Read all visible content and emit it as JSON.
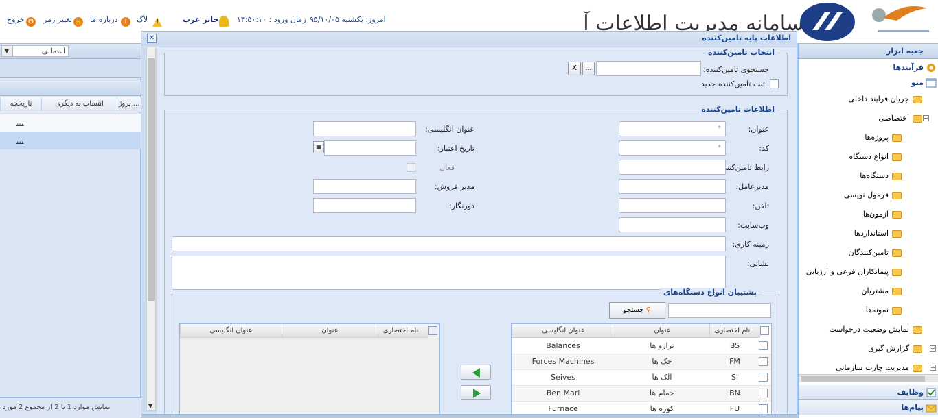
{
  "header": {
    "exit": "خروج",
    "change_password": "تغییر رمز",
    "about": "درباره ما",
    "log": "لاگ",
    "user": "جابر عرب",
    "login_time": "زمان ورود : ۱۳:۵۰:۱۰",
    "today": "امروز: یکشنبه ۹۵/۱۰/۰۵",
    "banner": "سامانه مدیریت اطلاعات آزمایشگاه"
  },
  "left_panel": {
    "theme_value": "آسمانی",
    "columns": [
      "تاریخچه",
      "انتساب به دیگری",
      "پروژ ..."
    ],
    "rows": [
      "...",
      "..."
    ],
    "status": "نمایش موارد 1 تا 2 از مجموع 2 مورد"
  },
  "right_panel": {
    "toolbox": "جعبه ابزار",
    "processes": "فرآیندها",
    "menu": "منو",
    "tree": [
      {
        "label": "جریان فرایند داخلی",
        "level": 1
      },
      {
        "label": "اختصاصی",
        "level": 1,
        "toggle": "−"
      },
      {
        "label": "پروژه‌ها",
        "level": 2
      },
      {
        "label": "انواع دستگاه",
        "level": 2
      },
      {
        "label": "دستگاه‌ها",
        "level": 2
      },
      {
        "label": "فرمول نویسی",
        "level": 2
      },
      {
        "label": "آزمون‌ها",
        "level": 2
      },
      {
        "label": "استانداردها",
        "level": 2
      },
      {
        "label": "تامین‌کنندگان",
        "level": 2
      },
      {
        "label": "پیمانکاران فرعی و ارزیابی",
        "level": 2
      },
      {
        "label": "مشتریان",
        "level": 2
      },
      {
        "label": "نمونه‌ها",
        "level": 2
      },
      {
        "label": "نمایش وضعیت درخواست",
        "level": 1
      },
      {
        "label": "گزارش گیری",
        "level": 1,
        "toggle": "+"
      },
      {
        "label": "مدیریت چارت سازمانی",
        "level": 1,
        "toggle": "+"
      }
    ],
    "tasks": "وظایف",
    "messages": "پیام‌ها"
  },
  "dialog": {
    "title": "اطلاعات پایه تامین‌کننده",
    "select_legend": "انتخاب تامین‌کننده",
    "search_label": "جستجوی تامین‌کننده:",
    "browse_btn": "...",
    "clear_btn": "X",
    "new_supplier": "ثبت تامین‌کننده جدید",
    "info_legend": "اطلاعات تامین‌کننده",
    "required_mark": "*",
    "fields": {
      "title": "عنوان:",
      "code": "کد:",
      "contact": "رابط تامین‌کننده:",
      "ceo": "مدیرعامل:",
      "phone": "تلفن:",
      "website": "وب‌سایت:",
      "field_of_work": "زمینه کاری:",
      "address": "نشانی:",
      "english_title": "عنوان انگلیسی:",
      "validity_date": "تاریخ اعتبار:",
      "active": "فعال",
      "sales_manager": "مدیر فروش:",
      "fax": "دورنگار:"
    },
    "devices_legend": "پشتیبان انواع دستگاه‌های",
    "search_btn": "جستجو",
    "grid_headers": [
      "نام اختصاری",
      "عنوان",
      "عنوان انگلیسی"
    ],
    "available": [
      {
        "abbr": "BS",
        "title": "ترازو ها",
        "en": "Balances"
      },
      {
        "abbr": "FM",
        "title": "جک ها",
        "en": "Forces Machines"
      },
      {
        "abbr": "SI",
        "title": "الک ها",
        "en": "Seives"
      },
      {
        "abbr": "BN",
        "title": "حمام ها",
        "en": "Ben Mari"
      },
      {
        "abbr": "FU",
        "title": "کوره ها",
        "en": "Furnace"
      }
    ]
  }
}
